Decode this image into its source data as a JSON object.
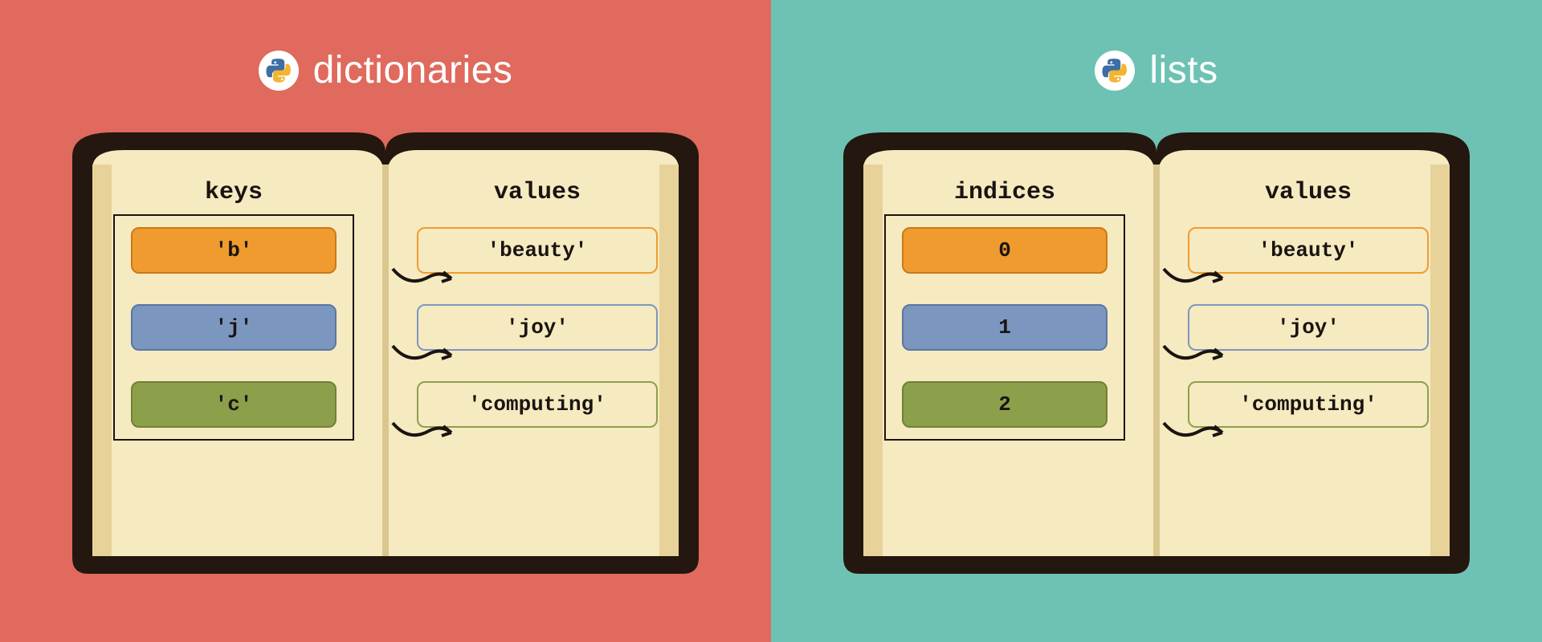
{
  "panels": [
    {
      "id": "dictionaries",
      "title": "dictionaries",
      "bg": "#df6a5d",
      "left_header": "keys",
      "right_header": "values",
      "rows": [
        {
          "key": "'b'",
          "value": "'beauty'",
          "color": "orange"
        },
        {
          "key": "'j'",
          "value": "'joy'",
          "color": "blue"
        },
        {
          "key": "'c'",
          "value": "'computing'",
          "color": "green"
        }
      ]
    },
    {
      "id": "lists",
      "title": "lists",
      "bg": "#6ec2b4",
      "left_header": "indices",
      "right_header": "values",
      "rows": [
        {
          "key": "0",
          "value": "'beauty'",
          "color": "orange"
        },
        {
          "key": "1",
          "value": "'joy'",
          "color": "blue"
        },
        {
          "key": "2",
          "value": "'computing'",
          "color": "green"
        }
      ]
    }
  ],
  "colors": {
    "orange": "#f09b2f",
    "blue": "#7c97bf",
    "green": "#8ca04c",
    "book_dark": "#23170f",
    "book_page": "#f6eac1",
    "book_shade": "#e7d39a"
  }
}
